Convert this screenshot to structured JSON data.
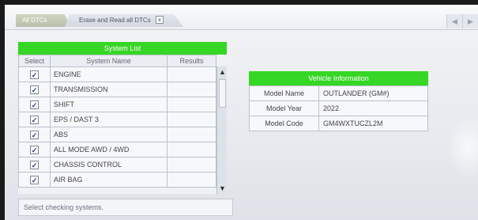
{
  "tabs": [
    {
      "label": "All DTCs"
    },
    {
      "label": "Erase and Read all DTCs",
      "close_icon": "close-icon"
    }
  ],
  "nav": {
    "prev_icon": "chevron-left-icon",
    "next_icon": "chevron-right-icon"
  },
  "system_list": {
    "title": "System List",
    "columns": [
      "Select",
      "System Name",
      "Results"
    ],
    "rows": [
      {
        "selected": true,
        "name": "ENGINE",
        "result": ""
      },
      {
        "selected": true,
        "name": "TRANSMISSION",
        "result": ""
      },
      {
        "selected": true,
        "name": "SHIFT",
        "result": ""
      },
      {
        "selected": true,
        "name": "EPS / DAST 3",
        "result": ""
      },
      {
        "selected": true,
        "name": "ABS",
        "result": ""
      },
      {
        "selected": true,
        "name": "ALL MODE AWD / 4WD",
        "result": ""
      },
      {
        "selected": true,
        "name": "CHASSIS CONTROL",
        "result": ""
      },
      {
        "selected": true,
        "name": "AIR BAG",
        "result": ""
      }
    ],
    "check_glyph": "✓"
  },
  "status": {
    "text": "Select checking systems."
  },
  "vehicle_info": {
    "title": "Vehicle Information",
    "fields": [
      {
        "label": "Model Name",
        "value": "OUTLANDER (GM#)"
      },
      {
        "label": "Model Year",
        "value": "2022"
      },
      {
        "label": "Model Code",
        "value": "GM4WXTUCZL2M"
      }
    ]
  },
  "colors": {
    "header_green": "#35d624",
    "background": "#eef1f5"
  }
}
